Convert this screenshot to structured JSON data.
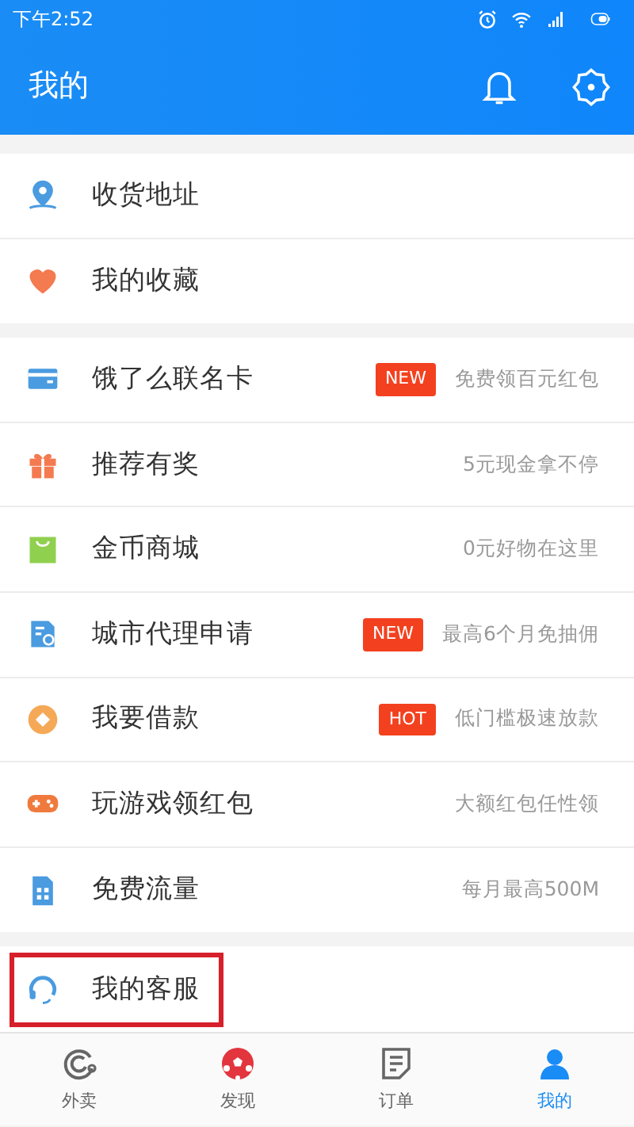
{
  "status_bar": {
    "time": "下午2:52"
  },
  "header": {
    "title": "我的"
  },
  "groups": [
    {
      "items": [
        {
          "kind": "pin",
          "label": "收货地址",
          "highlighted": false
        },
        {
          "kind": "heart",
          "label": "我的收藏",
          "highlighted": false
        }
      ]
    },
    {
      "items": [
        {
          "kind": "card",
          "label": "饿了么联名卡",
          "badge": "NEW",
          "hint": "免费领百元红包",
          "highlighted": false
        },
        {
          "kind": "gift",
          "label": "推荐有奖",
          "hint": "5元现金拿不停",
          "highlighted": false
        },
        {
          "kind": "bag",
          "label": "金币商城",
          "hint": "0元好物在这里",
          "highlighted": false
        },
        {
          "kind": "doc",
          "label": "城市代理申请",
          "badge": "NEW",
          "hint": "最高6个月免抽佣",
          "highlighted": false
        },
        {
          "kind": "coin",
          "label": "我要借款",
          "badge": "HOT",
          "hint": "低门槛极速放款",
          "highlighted": false
        },
        {
          "kind": "gamepad",
          "label": "玩游戏领红包",
          "hint": "大额红包任性领",
          "highlighted": false
        },
        {
          "kind": "sim",
          "label": "免费流量",
          "hint": "每月最高500M",
          "highlighted": false
        }
      ]
    },
    {
      "items": [
        {
          "kind": "headset",
          "label": "我的客服",
          "highlighted": true
        }
      ]
    }
  ],
  "tabs": [
    {
      "kind": "swirl",
      "label": "外卖",
      "selected": false
    },
    {
      "kind": "ball",
      "label": "发现",
      "selected": false
    },
    {
      "kind": "note",
      "label": "订单",
      "selected": false
    },
    {
      "kind": "person",
      "label": "我的",
      "selected": true
    }
  ]
}
